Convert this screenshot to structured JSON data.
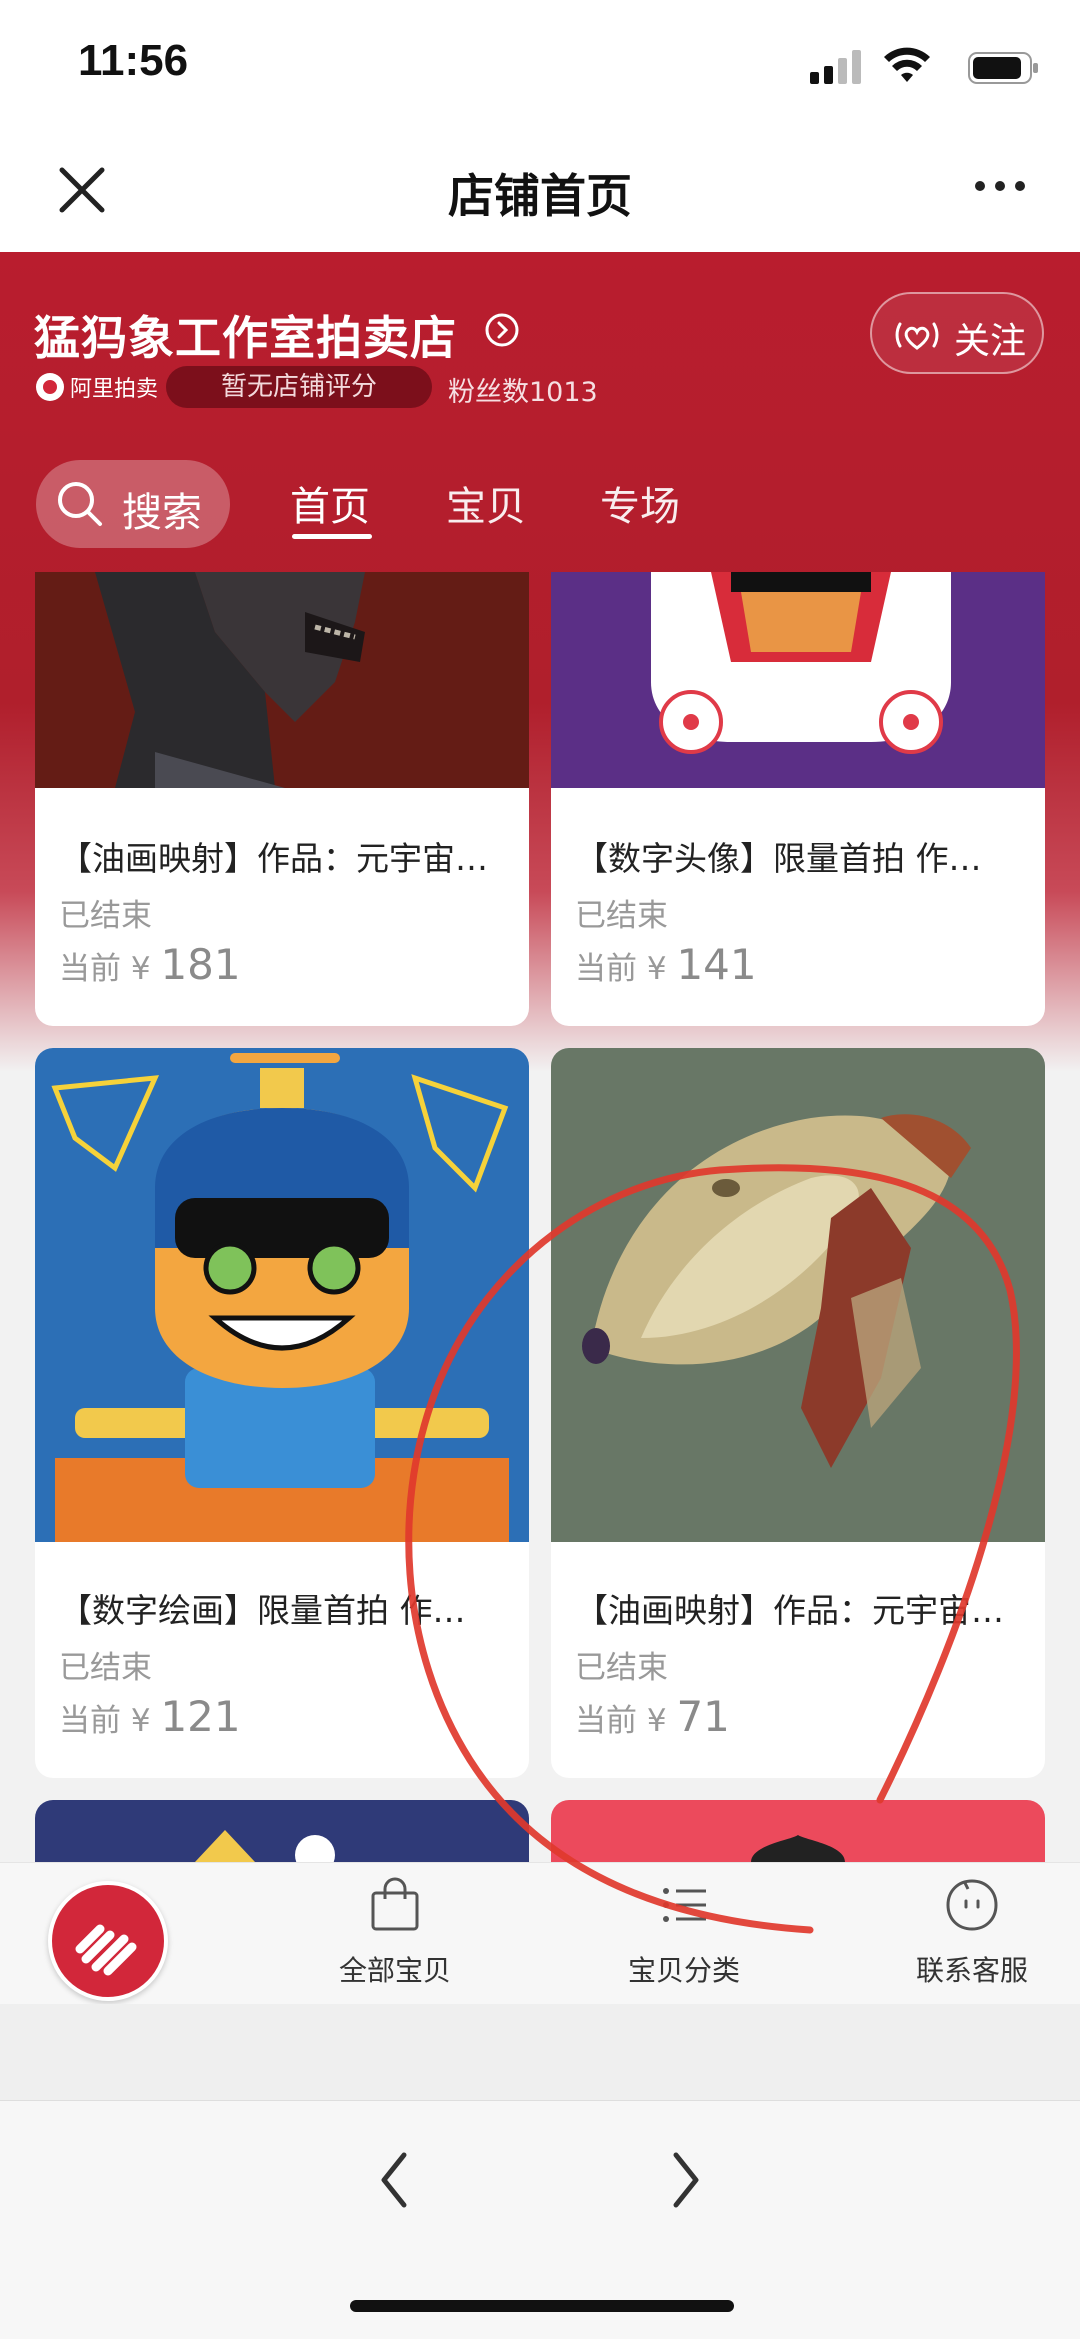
{
  "status_bar": {
    "time": "11:56"
  },
  "nav": {
    "title": "店铺首页"
  },
  "shop": {
    "name": "猛犸象工作室拍卖店",
    "platform_badge": "阿里拍卖",
    "rating": "暂无店铺评分",
    "fans": "粉丝数1013",
    "follow_label": "关注"
  },
  "tabs": {
    "search_label": "搜索",
    "items": [
      "首页",
      "宝贝",
      "专场"
    ],
    "active": "首页"
  },
  "products": [
    {
      "title": "【油画映射】作品：元宇宙…",
      "status": "已结束",
      "price_prefix": "当前 ¥",
      "price": "181"
    },
    {
      "title": "【数字头像】限量首拍 作…",
      "status": "已结束",
      "price_prefix": "当前 ¥",
      "price": "141"
    },
    {
      "title": "【数字绘画】限量首拍 作…",
      "status": "已结束",
      "price_prefix": "当前 ¥",
      "price": "121"
    },
    {
      "title": "【油画映射】作品：元宇宙…",
      "status": "已结束",
      "price_prefix": "当前 ¥",
      "price": "71"
    }
  ],
  "bottom_bar": {
    "all_items": "全部宝贝",
    "categories": "宝贝分类",
    "customer_service": "联系客服"
  },
  "colors": {
    "brand_red": "#b91d2e",
    "annotation_red": "#e0382c"
  },
  "icons": [
    "close-icon",
    "more-icon",
    "chevron-right-icon",
    "heart-signal-icon",
    "search-icon",
    "shopping-bag-icon",
    "list-icon",
    "chat-bot-icon",
    "back-arrow-icon",
    "forward-arrow-icon"
  ]
}
